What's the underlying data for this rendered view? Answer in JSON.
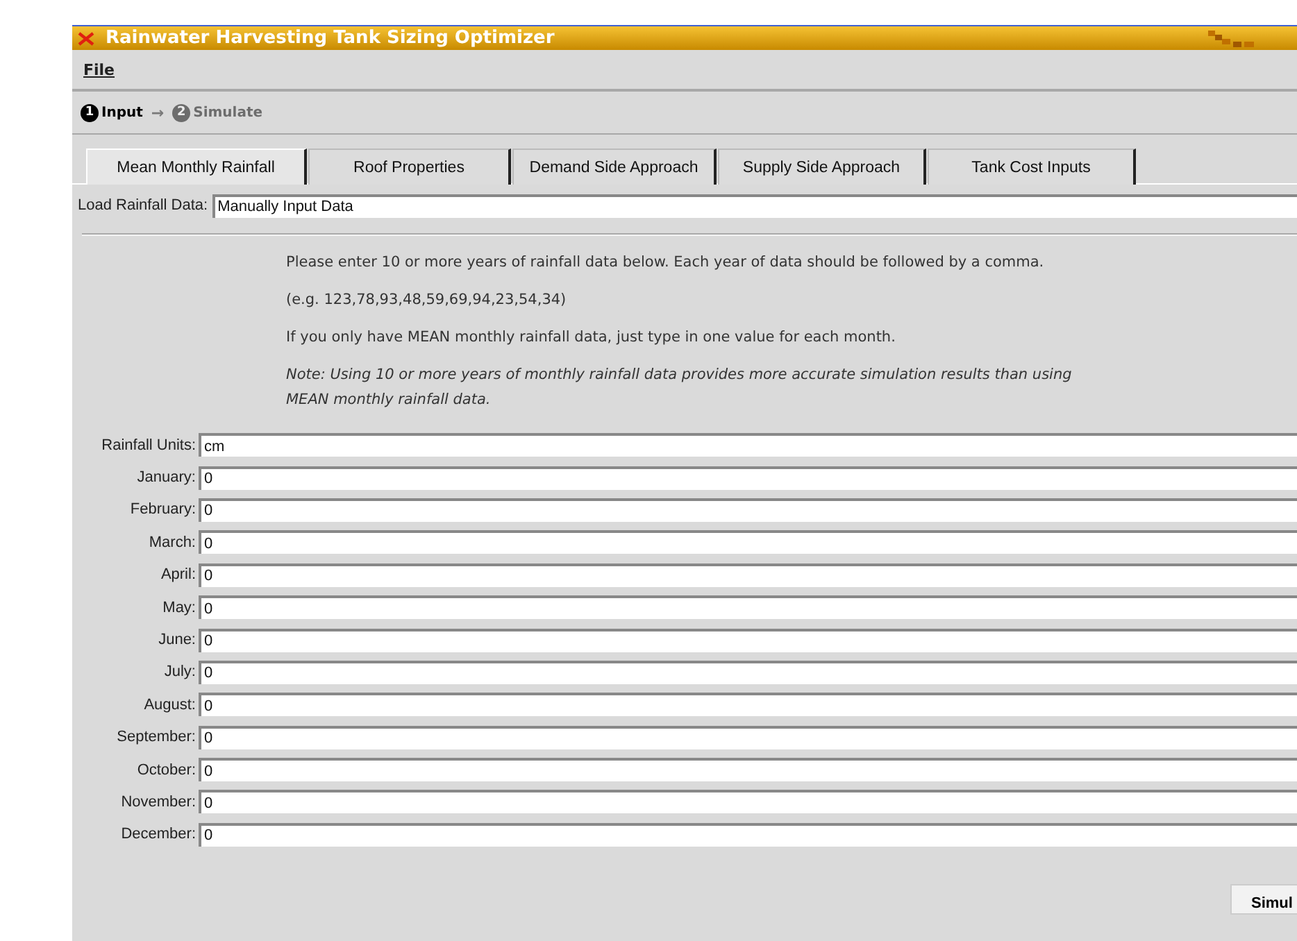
{
  "window": {
    "title": "Rainwater Harvesting Tank Sizing Optimizer"
  },
  "menu": [
    "File"
  ],
  "steps": [
    {
      "number": "1",
      "label": "Input",
      "selected": true
    },
    {
      "number": "2",
      "label": "Simulate",
      "selected": false
    }
  ],
  "step_arrow": "→",
  "tabs": [
    {
      "label": "Mean Monthly Rainfall",
      "selected": true
    },
    {
      "label": "Roof Properties",
      "selected": false
    },
    {
      "label": "Demand Side Approach",
      "selected": false
    },
    {
      "label": "Supply Side Approach",
      "selected": false
    },
    {
      "label": "Tank Cost Inputs",
      "selected": false
    }
  ],
  "load": {
    "label": "Load Rainfall Data:",
    "value": "Manually Input Data"
  },
  "instructions": [
    {
      "text": "Please enter 10 or more years of rainfall data below. Each year of data should be followed by a comma.",
      "italic": false
    },
    {
      "text": "(e.g. 123,78,93,48,59,69,94,23,54,34)",
      "italic": false
    },
    {
      "text": "If you only have MEAN monthly rainfall data, just type in  one value for each month.",
      "italic": false
    },
    {
      "text": "Note: Using 10 or more years of monthly rainfall data provides more accurate simulation results than using MEAN monthly rainfall data.",
      "italic": true
    }
  ],
  "fields": [
    {
      "label": "Rainfall Units:",
      "value": "cm"
    },
    {
      "label": "January:",
      "value": "0"
    },
    {
      "label": "February:",
      "value": "0"
    },
    {
      "label": "March:",
      "value": "0"
    },
    {
      "label": "April:",
      "value": "0"
    },
    {
      "label": "May:",
      "value": "0"
    },
    {
      "label": "June:",
      "value": "0"
    },
    {
      "label": "July:",
      "value": "0"
    },
    {
      "label": "August:",
      "value": "0"
    },
    {
      "label": "September:",
      "value": "0"
    },
    {
      "label": "October:",
      "value": "0"
    },
    {
      "label": "November:",
      "value": "0"
    },
    {
      "label": "December:",
      "value": "0"
    }
  ],
  "simulate_button": "Simul"
}
